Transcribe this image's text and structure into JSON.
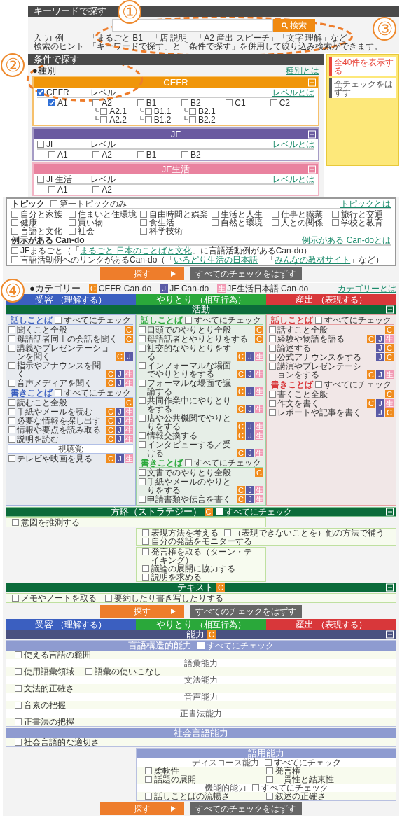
{
  "annotations": [
    {
      "text": "①",
      "outlined": true
    },
    {
      "text": "②",
      "outlined": true
    },
    {
      "text": "③",
      "outlined": false
    },
    {
      "text": "④",
      "outlined": false
    }
  ],
  "keyword_search": {
    "title": "キーワードで探す",
    "button": "検索",
    "example_label": "入 力 例",
    "example": "「まるごと B1」「店 説明」「A2 産出 スピーチ」「文字 理解」など",
    "hint_label": "検索のヒント",
    "hint": "「キーワードで探す」と「条件で探す」を併用して絞り込み検索ができます。"
  },
  "condition_search": {
    "title": "条件で探す",
    "type_title": "●種別",
    "type_link": "種別とは",
    "panels": [
      {
        "title": "CEFR",
        "color": "#f0960a",
        "checkbox": {
          "label": "CEFR",
          "checked": true
        },
        "level_label": "レベル",
        "level_link": "レベルとは",
        "levels": [
          {
            "label": "A1",
            "checked": true
          },
          {
            "label": "A2",
            "checked": false,
            "children": [
              {
                "label": "A2.1",
                "checked": false
              },
              {
                "label": "A2.2",
                "checked": false
              }
            ]
          },
          {
            "label": "B1",
            "checked": false,
            "children": [
              {
                "label": "B1.1",
                "checked": false
              },
              {
                "label": "B1.2",
                "checked": false
              }
            ]
          },
          {
            "label": "B2",
            "checked": false,
            "children": [
              {
                "label": "B2.1",
                "checked": false
              },
              {
                "label": "B2.2",
                "checked": false
              }
            ]
          },
          {
            "label": "C1",
            "checked": false
          },
          {
            "label": "C2",
            "checked": false
          }
        ]
      },
      {
        "title": "JF",
        "color": "#6a5aa0",
        "checkbox": {
          "label": "JF",
          "checked": false
        },
        "level_label": "レベル",
        "level_link": "レベルとは",
        "levels": [
          {
            "label": "A1",
            "checked": false
          },
          {
            "label": "A2",
            "checked": false
          },
          {
            "label": "B1",
            "checked": false
          },
          {
            "label": "B2",
            "checked": false
          }
        ]
      },
      {
        "title": "JF生活",
        "color": "#e9829f",
        "checkbox": {
          "label": "JF生活",
          "checked": false
        },
        "level_label": "レベル",
        "level_link": "レベルとは",
        "levels": [
          {
            "label": "A1",
            "checked": false
          },
          {
            "label": "A2",
            "checked": false
          }
        ]
      }
    ],
    "topics": {
      "title": "トピック",
      "first_only": {
        "label": "第一トピックのみ",
        "checked": false
      },
      "link": "トピックとは",
      "items": [
        {
          "label": "自分と家族",
          "checked": false
        },
        {
          "label": "住まいと住環境",
          "checked": false
        },
        {
          "label": "自由時間と娯楽",
          "checked": false
        },
        {
          "label": "生活と人生",
          "checked": false
        },
        {
          "label": "仕事と職業",
          "checked": false
        },
        {
          "label": "旅行と交通",
          "checked": false
        },
        {
          "label": "健康",
          "checked": false
        },
        {
          "label": "買い物",
          "checked": false
        },
        {
          "label": "食生活",
          "checked": false
        },
        {
          "label": "自然と環境",
          "checked": false
        },
        {
          "label": "人との関係",
          "checked": false
        },
        {
          "label": "学校と教育",
          "checked": false
        },
        {
          "label": "言語と文化",
          "checked": false
        },
        {
          "label": "社会",
          "checked": false
        },
        {
          "label": "科学技術",
          "checked": false
        }
      ]
    },
    "examples": {
      "title": "例示がある Can-do",
      "link": "例示がある Can-doとは",
      "items": [
        {
          "checked": false,
          "parts": [
            {
              "text": "JFまるごと（「"
            },
            {
              "text": "まるごと 日本のことばと文化",
              "link": true
            },
            {
              "text": "」に言語活動例があるCan-do）"
            }
          ]
        },
        {
          "checked": false,
          "parts": [
            {
              "text": "言語活動例へのリンクがあるCan-do（「"
            },
            {
              "text": "いろどり生活の日本語",
              "link": true
            },
            {
              "text": "」「"
            },
            {
              "text": "みんなの教材サイト",
              "link": true
            },
            {
              "text": "」など）"
            }
          ]
        }
      ]
    },
    "buttons": {
      "search": "探す",
      "clear": "すべてのチェックをはずす"
    }
  },
  "sidebar": {
    "buttons": [
      {
        "label": "全40件を表示する",
        "color": "#e8473c"
      },
      {
        "label": "全チェックをはずす",
        "color": "#555555"
      }
    ]
  },
  "category": {
    "title": "●カテゴリー",
    "link": "カテゴリーとは",
    "legend": [
      {
        "kind": "cefr",
        "badge": "C",
        "label": "CEFR Can-do"
      },
      {
        "kind": "jf",
        "badge": "J",
        "label": "JF Can-do"
      },
      {
        "kind": "life",
        "badge": "生",
        "label": "JF生活日本語 Can-do"
      }
    ],
    "modes": [
      {
        "title": "受容",
        "note": "（理解する）",
        "color": "#3b5fc0"
      },
      {
        "title": "やりとり",
        "note": "（相互行為）",
        "color": "#2aa83a"
      },
      {
        "title": "産出",
        "note": "（表現する）",
        "color": "#d8373a"
      }
    ],
    "activity": {
      "title": "活動",
      "groups": [
        {
          "columns": [
            {
              "title": "話しことば",
              "check_all": {
                "label": "すべてにチェック",
                "checked": false
              },
              "items": [
                {
                  "label": "聞くこと全般",
                  "checked": false,
                  "badges": [
                    {
                      "kind": "cefr",
                      "text": "C"
                    }
                  ]
                },
                {
                  "label": "母語話者同士の会話を聞く",
                  "checked": false,
                  "badges": [
                    {
                      "kind": "cefr",
                      "text": "C"
                    }
                  ]
                },
                {
                  "label": "講義やプレゼンテーションを聞く",
                  "checked": false,
                  "badges": [
                    {
                      "kind": "cefr",
                      "text": "C"
                    },
                    {
                      "kind": "jf",
                      "text": "J"
                    }
                  ]
                },
                {
                  "label": "指示やアナウンスを聞く",
                  "checked": false,
                  "badges": [
                    {
                      "kind": "cefr",
                      "text": "C"
                    },
                    {
                      "kind": "jf",
                      "text": "J"
                    },
                    {
                      "kind": "life",
                      "text": "生"
                    }
                  ]
                },
                {
                  "label": "音声メディアを聞く",
                  "checked": false,
                  "badges": [
                    {
                      "kind": "cefr",
                      "text": "C"
                    },
                    {
                      "kind": "jf",
                      "text": "J"
                    },
                    {
                      "kind": "life",
                      "text": "生"
                    }
                  ]
                }
              ]
            },
            {
              "title": "書きことば",
              "check_all": {
                "label": "すべてにチェック",
                "checked": false
              },
              "items": [
                {
                  "label": "読むこと全般",
                  "checked": false,
                  "badges": [
                    {
                      "kind": "cefr",
                      "text": "C"
                    }
                  ]
                },
                {
                  "label": "手紙やメールを読む",
                  "checked": false,
                  "badges": [
                    {
                      "kind": "cefr",
                      "text": "C"
                    },
                    {
                      "kind": "jf",
                      "text": "J"
                    },
                    {
                      "kind": "life",
                      "text": "生"
                    }
                  ]
                },
                {
                  "label": "必要な情報を探し出す",
                  "checked": false,
                  "badges": [
                    {
                      "kind": "cefr",
                      "text": "C"
                    },
                    {
                      "kind": "jf",
                      "text": "J"
                    },
                    {
                      "kind": "life",
                      "text": "生"
                    }
                  ]
                },
                {
                  "label": "情報や要点を読み取る",
                  "checked": false,
                  "badges": [
                    {
                      "kind": "cefr",
                      "text": "C"
                    },
                    {
                      "kind": "jf",
                      "text": "J"
                    },
                    {
                      "kind": "life",
                      "text": "生"
                    }
                  ]
                },
                {
                  "label": "説明を読む",
                  "checked": false,
                  "badges": [
                    {
                      "kind": "cefr",
                      "text": "C"
                    },
                    {
                      "kind": "jf",
                      "text": "J"
                    },
                    {
                      "kind": "life",
                      "text": "生"
                    }
                  ]
                }
              ]
            }
          ],
          "extra": {
            "title": "視聴覚",
            "items": [
              {
                "label": "テレビや映画を見る",
                "checked": false,
                "badges": [
                  {
                    "kind": "cefr",
                    "text": "C"
                  },
                  {
                    "kind": "jf",
                    "text": "J"
                  },
                  {
                    "kind": "life",
                    "text": "生"
                  }
                ]
              }
            ]
          }
        },
        {
          "columns": [
            {
              "title": "話しことば",
              "check_all": {
                "label": "すべてにチェック",
                "checked": false
              },
              "items": [
                {
                  "label": "口頭でのやりとり全般",
                  "checked": false,
                  "badges": [
                    {
                      "kind": "cefr",
                      "text": "C"
                    }
                  ]
                },
                {
                  "label": "母語話者とやりとりをする",
                  "checked": false,
                  "badges": [
                    {
                      "kind": "cefr",
                      "text": "C"
                    }
                  ]
                },
                {
                  "label": "社交的なやりとりをする",
                  "checked": false,
                  "badges": [
                    {
                      "kind": "cefr",
                      "text": "C"
                    },
                    {
                      "kind": "jf",
                      "text": "J"
                    },
                    {
                      "kind": "life",
                      "text": "生"
                    }
                  ]
                },
                {
                  "label": "インフォーマルな場面でやりとりをする",
                  "checked": false,
                  "badges": [
                    {
                      "kind": "cefr",
                      "text": "C"
                    },
                    {
                      "kind": "jf",
                      "text": "J"
                    },
                    {
                      "kind": "life",
                      "text": "生"
                    }
                  ]
                },
                {
                  "label": "フォーマルな場面で議論する",
                  "checked": false,
                  "badges": [
                    {
                      "kind": "cefr",
                      "text": "C"
                    },
                    {
                      "kind": "jf",
                      "text": "J"
                    },
                    {
                      "kind": "life",
                      "text": "生"
                    }
                  ]
                },
                {
                  "label": "共同作業中にやりとりをする",
                  "checked": false,
                  "badges": [
                    {
                      "kind": "cefr",
                      "text": "C"
                    },
                    {
                      "kind": "jf",
                      "text": "J"
                    },
                    {
                      "kind": "life",
                      "text": "生"
                    }
                  ]
                },
                {
                  "label": "店や公共機関でやりとりをする",
                  "checked": false,
                  "badges": [
                    {
                      "kind": "cefr",
                      "text": "C"
                    },
                    {
                      "kind": "jf",
                      "text": "J"
                    },
                    {
                      "kind": "life",
                      "text": "生"
                    }
                  ]
                },
                {
                  "label": "情報交換する",
                  "checked": false,
                  "badges": [
                    {
                      "kind": "cefr",
                      "text": "C"
                    },
                    {
                      "kind": "jf",
                      "text": "J"
                    },
                    {
                      "kind": "life",
                      "text": "生"
                    }
                  ]
                },
                {
                  "label": "インタビューする／受ける",
                  "checked": false,
                  "badges": [
                    {
                      "kind": "cefr",
                      "text": "C"
                    },
                    {
                      "kind": "jf",
                      "text": "J"
                    },
                    {
                      "kind": "life",
                      "text": "生"
                    }
                  ]
                }
              ]
            },
            {
              "title": "書きことば",
              "check_all": {
                "label": "すべてにチェック",
                "checked": false
              },
              "items": [
                {
                  "label": "文書でのやりとり全般",
                  "checked": false,
                  "badges": [
                    {
                      "kind": "cefr",
                      "text": "C"
                    }
                  ]
                },
                {
                  "label": "手紙やメールのやりとりをする",
                  "checked": false,
                  "badges": [
                    {
                      "kind": "cefr",
                      "text": "C"
                    },
                    {
                      "kind": "jf",
                      "text": "J"
                    },
                    {
                      "kind": "life",
                      "text": "生"
                    }
                  ]
                },
                {
                  "label": "申請書類や伝言を書く",
                  "checked": false,
                  "badges": [
                    {
                      "kind": "cefr",
                      "text": "C"
                    },
                    {
                      "kind": "jf",
                      "text": "J"
                    },
                    {
                      "kind": "life",
                      "text": "生"
                    }
                  ]
                }
              ]
            }
          ]
        },
        {
          "columns": [
            {
              "title": "話しことば",
              "check_all": {
                "label": "すべてにチェック",
                "checked": false
              },
              "items": [
                {
                  "label": "話すこと全般",
                  "checked": false,
                  "badges": [
                    {
                      "kind": "cefr",
                      "text": "C"
                    }
                  ]
                },
                {
                  "label": "経験や物語を語る",
                  "checked": false,
                  "badges": [
                    {
                      "kind": "cefr",
                      "text": "C"
                    },
                    {
                      "kind": "jf",
                      "text": "J"
                    },
                    {
                      "kind": "life",
                      "text": "生"
                    }
                  ]
                },
                {
                  "label": "論述する",
                  "checked": false,
                  "badges": [
                    {
                      "kind": "jf",
                      "text": "J"
                    },
                    {
                      "kind": "cefr",
                      "text": "C"
                    }
                  ]
                },
                {
                  "label": "公式アナウンスをする",
                  "checked": false,
                  "badges": [
                    {
                      "kind": "jf",
                      "text": "J"
                    },
                    {
                      "kind": "cefr",
                      "text": "C"
                    }
                  ]
                },
                {
                  "label": "講演やプレゼンテーションをする",
                  "checked": false,
                  "badges": [
                    {
                      "kind": "cefr",
                      "text": "C"
                    },
                    {
                      "kind": "jf",
                      "text": "J"
                    },
                    {
                      "kind": "life",
                      "text": "生"
                    }
                  ]
                }
              ]
            },
            {
              "title": "書きことば",
              "check_all": {
                "label": "すべてにチェック",
                "checked": false
              },
              "items": [
                {
                  "label": "書くこと全般",
                  "checked": false,
                  "badges": [
                    {
                      "kind": "cefr",
                      "text": "C"
                    }
                  ]
                },
                {
                  "label": "作文を書く",
                  "checked": false,
                  "badges": [
                    {
                      "kind": "cefr",
                      "text": "C"
                    },
                    {
                      "kind": "jf",
                      "text": "J"
                    },
                    {
                      "kind": "life",
                      "text": "生"
                    }
                  ]
                },
                {
                  "label": "レポートや記事を書く",
                  "checked": false,
                  "badges": [
                    {
                      "kind": "jf",
                      "text": "J"
                    },
                    {
                      "kind": "cefr",
                      "text": "C"
                    }
                  ]
                }
              ]
            }
          ]
        }
      ]
    },
    "strategy": {
      "title": "方略（ストラテジー）",
      "badge": {
        "kind": "cefr",
        "text": "C"
      },
      "check_all": {
        "label": "すべてにチェック",
        "checked": false
      },
      "groups": [
        {
          "kind": "wide",
          "items": [
            {
              "label": "意図を推測する",
              "checked": false
            }
          ]
        },
        {
          "kind": "right",
          "items": [
            {
              "label": "表現方法を考える",
              "checked": false
            },
            {
              "label": "（表現できないことを）他の方法で補う",
              "checked": false
            },
            {
              "label": "自分の発話をモニターする",
              "checked": false
            }
          ]
        },
        {
          "kind": "middle",
          "items": [
            {
              "label": "発言権を取る（ターン・テイキング）",
              "checked": false
            },
            {
              "label": "議論の展開に協力する",
              "checked": false
            },
            {
              "label": "説明を求める",
              "checked": false
            }
          ]
        }
      ]
    },
    "text": {
      "title": "テキスト",
      "badge": {
        "kind": "cefr",
        "text": "C"
      },
      "items": [
        {
          "label": "メモやノートを取る",
          "checked": false
        },
        {
          "label": "要約したり書き写したりする",
          "checked": false
        }
      ]
    },
    "buttons": {
      "search": "探す",
      "clear": "すべてのチェックをはずす"
    }
  },
  "ability": {
    "modes": [
      {
        "title": "受容",
        "note": "（理解する）",
        "color": "#3b5fc0"
      },
      {
        "title": "やりとり",
        "note": "（相互行為）",
        "color": "#2aa83a"
      },
      {
        "title": "産出",
        "note": "（表現する）",
        "color": "#d8373a"
      }
    ],
    "title": "能力",
    "badge": {
      "kind": "cefr",
      "text": "C"
    },
    "sections": [
      {
        "title": "言語構造的能力",
        "kind": "wide",
        "check_all": {
          "label": "すべてにチェック",
          "checked": false
        },
        "rows": [
          {
            "kind": "items",
            "items": [
              {
                "label": "使える言語の範囲",
                "checked": false
              }
            ]
          },
          {
            "kind": "subheading",
            "label": "語彙能力"
          },
          {
            "kind": "items",
            "items": [
              {
                "label": "使用語彙領域",
                "checked": false
              },
              {
                "label": "語彙の使いこなし",
                "checked": false
              }
            ]
          },
          {
            "kind": "subheading",
            "label": "文法能力"
          },
          {
            "kind": "items",
            "items": [
              {
                "label": "文法的正確さ",
                "checked": false
              }
            ]
          },
          {
            "kind": "subheading",
            "label": "音声能力"
          },
          {
            "kind": "items",
            "items": [
              {
                "label": "音素の把握",
                "checked": false
              }
            ]
          },
          {
            "kind": "subheading",
            "label": "正書法能力"
          },
          {
            "kind": "items",
            "items": [
              {
                "label": "正書法の把握",
                "checked": false
              }
            ]
          }
        ]
      },
      {
        "title": "社会言語能力",
        "kind": "wide",
        "rows": [
          {
            "kind": "items",
            "items": [
              {
                "label": "社会言語的な適切さ",
                "checked": false
              }
            ]
          }
        ]
      },
      {
        "title": "語用能力",
        "kind": "narrow",
        "rows": [
          {
            "kind": "subheading",
            "label": "ディスコース能力",
            "check_all": {
              "label": "すべてにチェック",
              "checked": false
            }
          },
          {
            "kind": "grid",
            "items": [
              {
                "label": "柔軟性",
                "checked": false
              },
              {
                "label": "発言権",
                "checked": false
              },
              {
                "label": "話題の展開",
                "checked": false
              },
              {
                "label": "一貫性と結束性",
                "checked": false
              }
            ]
          },
          {
            "kind": "subheading",
            "label": "機能的能力",
            "check_all": {
              "label": "すべてにチェック",
              "checked": false
            }
          },
          {
            "kind": "grid",
            "items": [
              {
                "label": "話しことばの流暢さ",
                "checked": false
              },
              {
                "label": "叙述の正確さ",
                "checked": false
              }
            ]
          }
        ]
      }
    ],
    "buttons": {
      "search": "探す",
      "clear": "すべてのチェックをはずす"
    }
  }
}
